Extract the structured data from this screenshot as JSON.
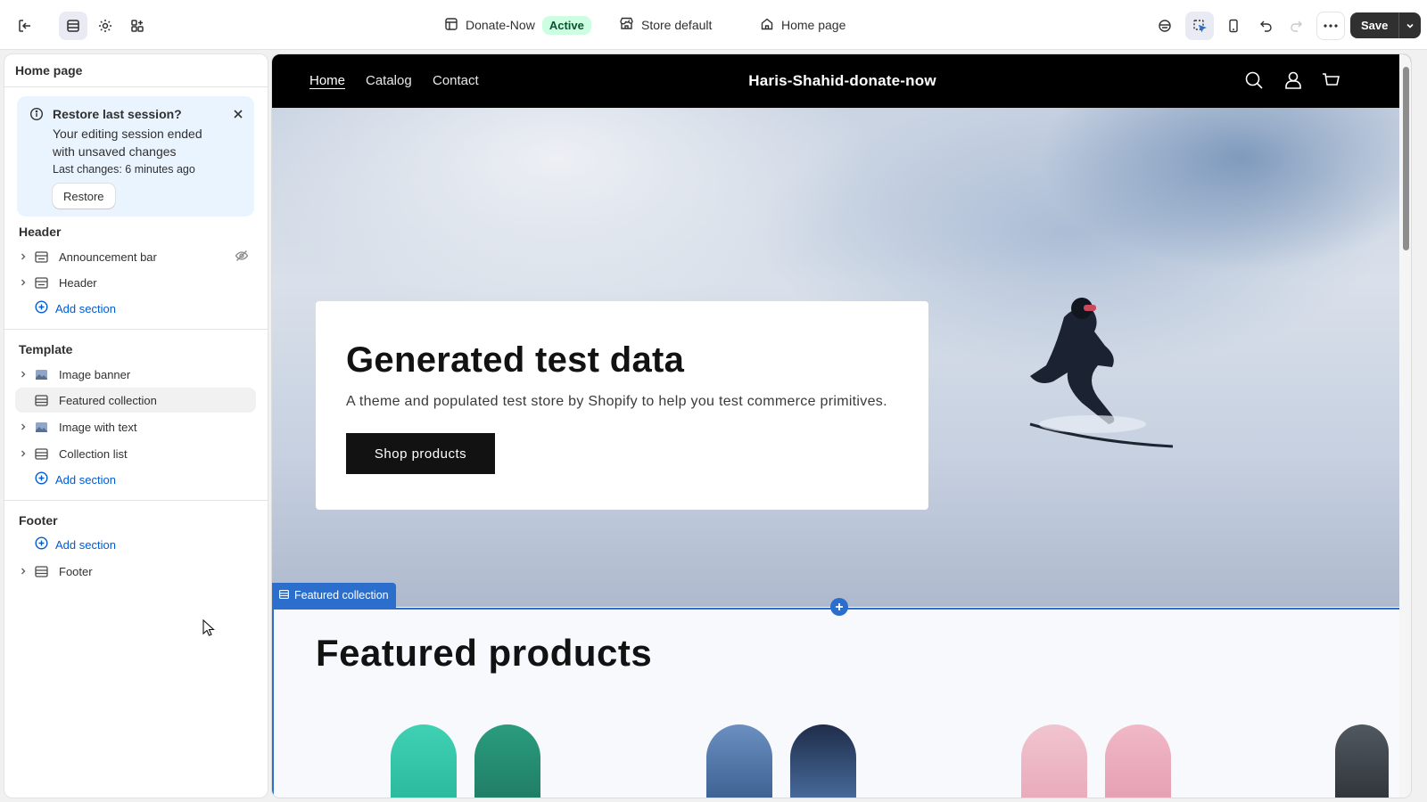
{
  "topbar": {
    "theme_name": "Donate-Now",
    "theme_status": "Active",
    "store_selector": "Store default",
    "page_selector": "Home page",
    "save_label": "Save"
  },
  "sidebar": {
    "title": "Home page",
    "restore": {
      "title": "Restore last session?",
      "message": "Your editing session ended with unsaved changes",
      "last_changes": "Last changes: 6 minutes ago",
      "button": "Restore"
    },
    "groups": [
      {
        "title": "Header",
        "items": [
          "Announcement bar",
          "Header"
        ],
        "add": "Add section"
      },
      {
        "title": "Template",
        "items": [
          "Image banner",
          "Featured collection",
          "Image with text",
          "Collection list"
        ],
        "add": "Add section"
      },
      {
        "title": "Footer",
        "items": [
          "Footer"
        ],
        "add": "Add section"
      }
    ]
  },
  "preview": {
    "nav": [
      "Home",
      "Catalog",
      "Contact"
    ],
    "store_name": "Haris-Shahid-donate-now",
    "hero": {
      "heading": "Generated test data",
      "text": "A theme and populated test store by Shopify to help you test commerce primitives.",
      "button": "Shop products"
    },
    "featured_tag": "Featured collection",
    "featured_heading": "Featured products"
  },
  "colors": {
    "accent": "#2c6ecb",
    "link": "#005bd3",
    "active_badge_bg": "#cdfee1",
    "save_bg": "#303030"
  }
}
